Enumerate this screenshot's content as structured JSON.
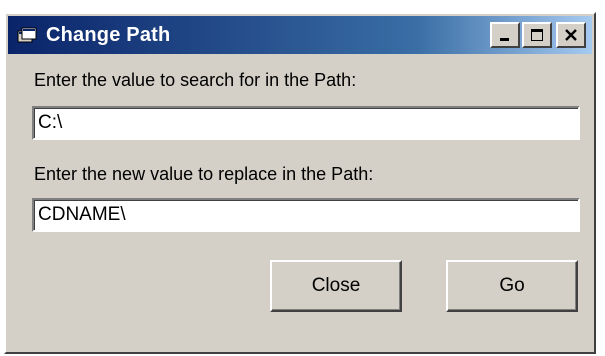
{
  "window": {
    "title": "Change Path",
    "icon": "app-icon",
    "controls": [
      "minimize-icon",
      "maximize-icon",
      "close-icon"
    ]
  },
  "search": {
    "label": "Enter the value to search for in the Path:",
    "value": "C:\\"
  },
  "replace": {
    "label": "Enter the new value to replace in the Path:",
    "value": "CDNAME\\"
  },
  "buttons": {
    "close_label": "Close",
    "go_label": "Go"
  },
  "colors": {
    "titlebar_start": "#0a246a",
    "titlebar_end": "#a6caf0",
    "face": "#d4d0c8"
  }
}
